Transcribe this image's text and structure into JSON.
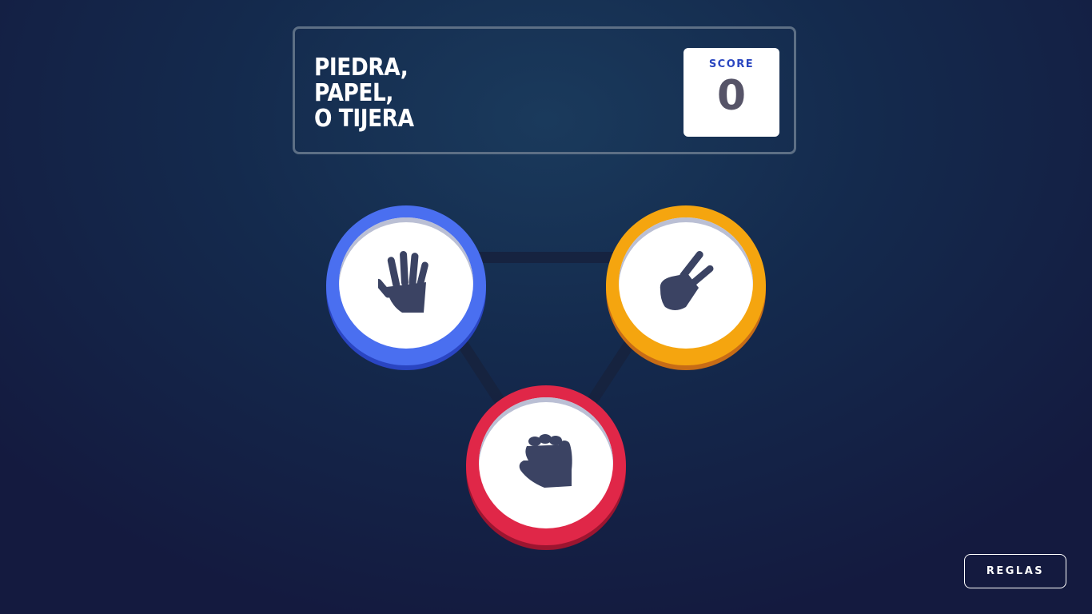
{
  "header": {
    "title_lines": [
      "PIEDRA,",
      "PAPEL,",
      "O TIJERA"
    ],
    "score_label": "SCORE",
    "score_value": "0"
  },
  "choices": [
    {
      "name": "paper",
      "icon": "hand-paper-icon",
      "color": "#4a6ff0"
    },
    {
      "name": "scissors",
      "icon": "hand-scissors-icon",
      "color": "#f5a50f"
    },
    {
      "name": "rock",
      "icon": "hand-rock-icon",
      "color": "#e02748"
    }
  ],
  "rules_button": {
    "label": "REGLAS"
  },
  "colors": {
    "background": "#142a4d",
    "header_border": "#5d6f85",
    "score_label": "#2a46c0",
    "score_value": "#565468",
    "icon": "#3b4363"
  }
}
